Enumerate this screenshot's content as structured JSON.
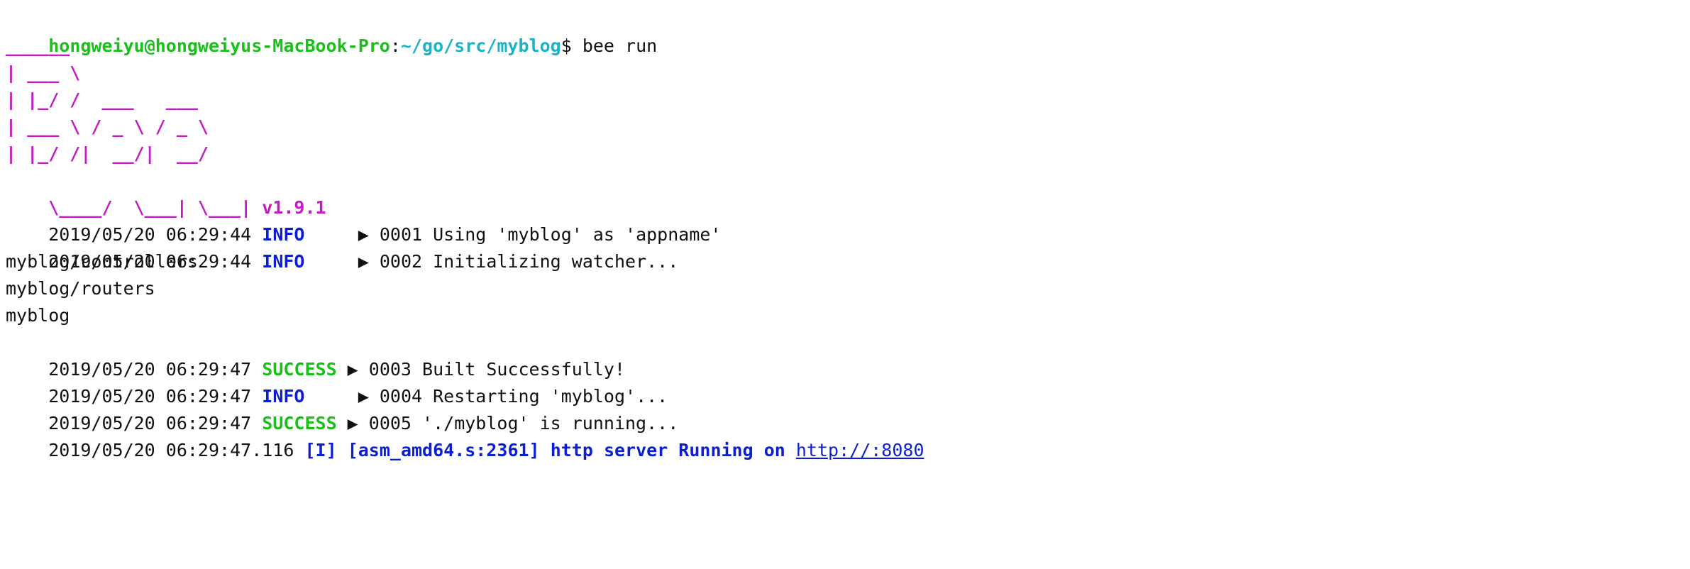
{
  "prompt": {
    "user_host": "hongweiyu@hongweiyus-MacBook-Pro",
    "separator": ":",
    "path": "~/go/src/myblog",
    "symbol": "$ ",
    "command": "bee run"
  },
  "banner": {
    "lines": [
      "______",
      "| ___ \\",
      "| |_/ /  ___   ___",
      "| ___ \\ / _ \\ / _ \\",
      "| |_/ /|  __/|  __/",
      "\\____/  \\___| \\___|"
    ],
    "version": "v1.9.1"
  },
  "logs": [
    {
      "timestamp": "2019/05/20 06:29:44",
      "level": "INFO",
      "message": "  ▶ 0001 Using 'myblog' as 'appname'"
    },
    {
      "timestamp": "2019/05/20 06:29:44",
      "level": "INFO",
      "message": "  ▶ 0002 Initializing watcher..."
    }
  ],
  "packages": [
    "myblog/controllers",
    "myblog/routers",
    "myblog"
  ],
  "logs2": [
    {
      "timestamp": "2019/05/20 06:29:47",
      "level": "SUCCESS",
      "message": " ▶ 0003 Built Successfully!"
    },
    {
      "timestamp": "2019/05/20 06:29:47",
      "level": "INFO",
      "message": "  ▶ 0004 Restarting 'myblog'..."
    },
    {
      "timestamp": "2019/05/20 06:29:47",
      "level": "SUCCESS",
      "message": " ▶ 0005 './myblog' is running..."
    }
  ],
  "server": {
    "timestamp": "2019/05/20 06:29:47.116",
    "tag": "[I]",
    "source": "[asm_amd64.s:2361]",
    "message": "http server Running on",
    "url": "http://:8080"
  },
  "colors": {
    "green": "#19c019",
    "cyan": "#19b5c6",
    "magenta": "#c41bc4",
    "blue": "#0b1fd1",
    "text": "#111111"
  }
}
